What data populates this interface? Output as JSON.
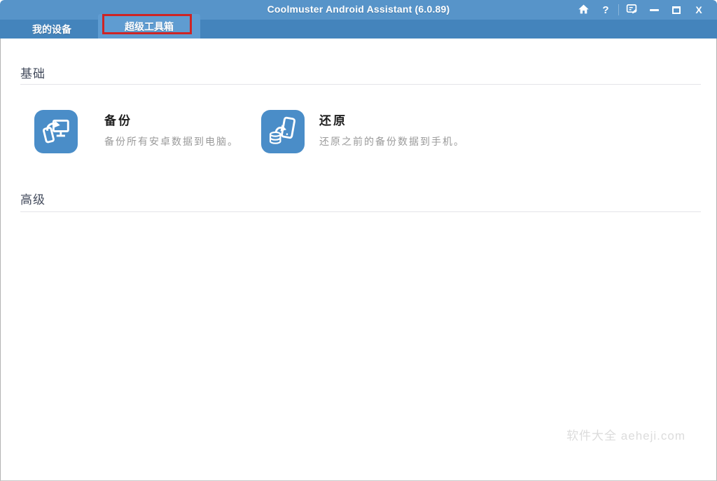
{
  "titlebar": {
    "title": "Coolmuster Android Assistant (6.0.89)",
    "help_label": "?",
    "close_label": "X"
  },
  "tabs": {
    "my_devices": "我的设备",
    "super_toolkit": "超级工具箱"
  },
  "sections": {
    "basic": {
      "title": "基础",
      "items": {
        "backup": {
          "title": "备份",
          "desc": "备份所有安卓数据到电脑。"
        },
        "restore": {
          "title": "还原",
          "desc": "还原之前的备份数据到手机。"
        }
      }
    },
    "advanced": {
      "title": "高级"
    }
  },
  "watermark": "软件大全 aeheji.com",
  "icons": {
    "home": "home-icon",
    "help": "question-mark-icon",
    "feedback": "feedback-note-icon",
    "minimize": "minimize-icon",
    "maximize": "maximize-icon",
    "close": "close-icon",
    "backup": "phone-to-computer-backup-icon",
    "restore": "database-to-phone-restore-icon"
  },
  "colors": {
    "titlebar": "#5794c9",
    "tabstrip": "#4484bc",
    "active_tab": "#5f9cd1",
    "annotation_red": "#ce2424",
    "icon_tile": "#4a8dc8",
    "section_text": "#434b5c",
    "desc_text": "#9a9a9a",
    "watermark_text": "#dcdcdc"
  }
}
